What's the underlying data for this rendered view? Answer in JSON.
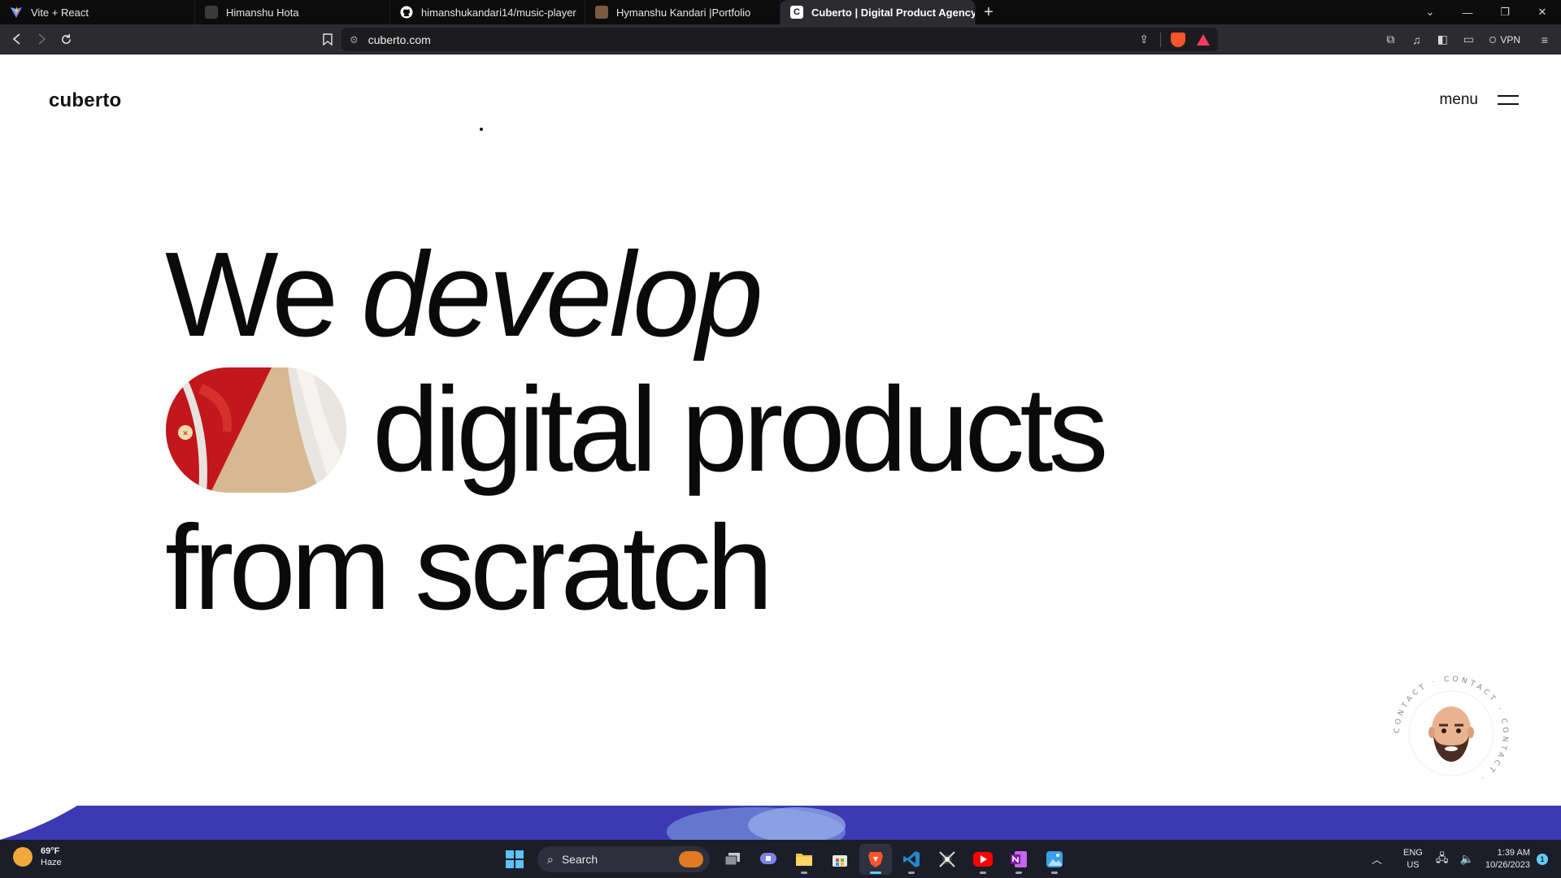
{
  "browser": {
    "tabs": [
      {
        "title": "Vite + React",
        "favicon": "vite-logo-icon",
        "active": false
      },
      {
        "title": "Himanshu Hota",
        "favicon": "profile-photo-icon",
        "active": false
      },
      {
        "title": "himanshukandari14/music-player",
        "favicon": "github-icon",
        "active": false
      },
      {
        "title": "Hymanshu Kandari |Portfolio",
        "favicon": "portfolio-icon",
        "active": false
      },
      {
        "title": "Cuberto | Digital Product Agency",
        "favicon": "cuberto-c-icon",
        "active": true
      }
    ],
    "url": "cuberto.com",
    "vpn_label": "VPN"
  },
  "site": {
    "logo": "cuberto",
    "menu_label": "menu",
    "hero": {
      "line1_plain": "We",
      "line1_italic": "develop",
      "line2": "digital products",
      "line3": "from scratch"
    },
    "contact_ring_text": "CONTACT · CONTACT · CONTACT ·"
  },
  "taskbar": {
    "weather_temp": "69°F",
    "weather_desc": "Haze",
    "search_label": "Search",
    "apps": [
      "windows-start-icon",
      "search",
      "task-view-icon",
      "teams-chat-icon",
      "file-explorer-icon",
      "microsoft-store-icon",
      "brave-browser-icon",
      "vscode-icon",
      "game-icon",
      "youtube-icon",
      "onenote-icon",
      "photos-icon"
    ],
    "lang_line1": "ENG",
    "lang_line2": "US",
    "time": "1:39 AM",
    "date": "10/26/2023",
    "notification_count": "1"
  },
  "colors": {
    "tab_bar": "#0c0c0d",
    "toolbar": "#2b2b30",
    "page_bg": "#ffffff",
    "hero_text": "#0a0a0a",
    "footer_band": "#3c39b3",
    "taskbar": "#1b1d28"
  }
}
